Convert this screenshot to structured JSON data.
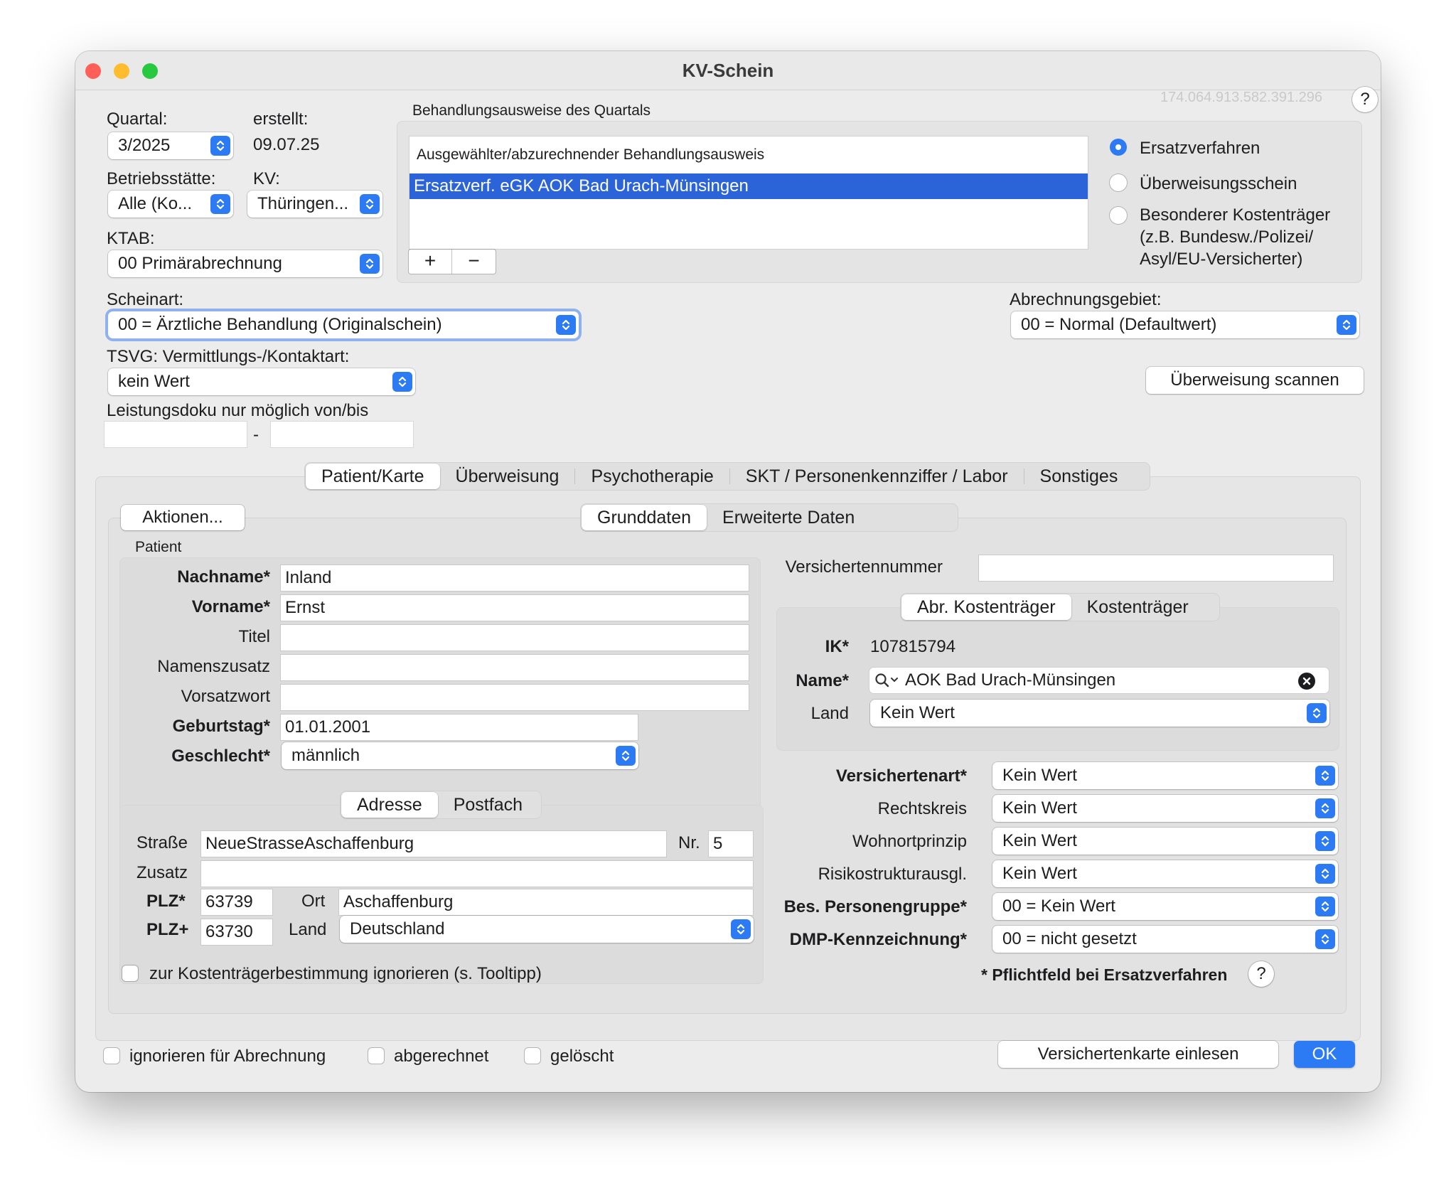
{
  "window": {
    "title": "KV-Schein",
    "id_text": "174.064.913.582.391.296"
  },
  "header": {
    "quartal_label": "Quartal:",
    "quartal_value": "3/2025",
    "erstellt_label": "erstellt:",
    "erstellt_value": "09.07.25",
    "betrieb_label": "Betriebsstätte:",
    "betrieb_value": "Alle (Ko...",
    "kv_label": "KV:",
    "kv_value": "Thüringen...",
    "ktab_label": "KTAB:",
    "ktab_value": "00 Primärabrechnung",
    "scheinart_label": "Scheinart:",
    "scheinart_value": "00 = Ärztliche Behandlung (Originalschein)",
    "abr_label": "Abrechnungsgebiet:",
    "abr_value": "00 = Normal (Defaultwert)",
    "tsvg_label": "TSVG: Vermittlungs-/Kontaktart:",
    "tsvg_value": "kein Wert",
    "leistung_label": "Leistungsdoku nur möglich von/bis",
    "dash": "-",
    "scan_button": "Überweisung scannen"
  },
  "behandlung": {
    "group_label": "Behandlungsausweise des Quartals",
    "list_header": "Ausgewählter/abzurechnender Behandlungsausweis",
    "selected_item": "Ersatzverf. eGK AOK Bad Urach-Münsingen",
    "add": "+",
    "remove": "−",
    "radio1": "Ersatzverfahren",
    "radio2": "Überweisungsschein",
    "radio3_line1": "Besonderer Kostenträger",
    "radio3_line2": "(z.B. Bundesw./Polizei/",
    "radio3_line3": "Asyl/EU-Versicherter)"
  },
  "tabs": [
    "Patient/Karte",
    "Überweisung",
    "Psychotherapie",
    "SKT / Personenkennziffer / Labor",
    "Sonstiges"
  ],
  "subtabs": [
    "Grunddaten",
    "Erweiterte Daten"
  ],
  "aktionen": "Aktionen...",
  "patient": {
    "group_label": "Patient",
    "nachname_label": "Nachname*",
    "nachname": "Inland",
    "vorname_label": "Vorname*",
    "vorname": "Ernst",
    "titel_label": "Titel",
    "titel": "",
    "namenszusatz_label": "Namenszusatz",
    "namenszusatz": "",
    "vorsatzwort_label": "Vorsatzwort",
    "vorsatzwort": "",
    "geburtstag_label": "Geburtstag*",
    "geburtstag": "01.01.2001",
    "geschlecht_label": "Geschlecht*",
    "geschlecht": "männlich"
  },
  "adresse": {
    "tabs": [
      "Adresse",
      "Postfach"
    ],
    "strasse_label": "Straße",
    "strasse": "NeueStrasseAschaffenburg",
    "nr_label": "Nr.",
    "nr": "5",
    "zusatz_label": "Zusatz",
    "zusatz": "",
    "plz_label": "PLZ*",
    "plz": "63739",
    "ort_label": "Ort",
    "ort": "Aschaffenburg",
    "plzplus_label": "PLZ+",
    "plzplus": "63730",
    "land_label": "Land",
    "land": "Deutschland",
    "ignore_label": "zur Kostenträgerbestimmung ignorieren (s. Tooltipp)"
  },
  "versicherung": {
    "vnr_label": "Versichertennummer",
    "vnr": "",
    "tabs": [
      "Abr. Kostenträger",
      "Kostenträger"
    ],
    "ik_label": "IK*",
    "ik": "107815794",
    "name_label": "Name*",
    "name": "AOK Bad Urach-Münsingen",
    "land_label": "Land",
    "land": "Kein Wert",
    "versichertenart_label": "Versichertenart*",
    "versichertenart": "Kein Wert",
    "rechtskreis_label": "Rechtskreis",
    "rechtskreis": "Kein Wert",
    "wohnort_label": "Wohnortprinzip",
    "wohnort": "Kein Wert",
    "risiko_label": "Risikostrukturausgl.",
    "risiko": "Kein Wert",
    "personengruppe_label": "Bes. Personengruppe*",
    "personengruppe": "00 = Kein Wert",
    "dmp_label": "DMP-Kennzeichnung*",
    "dmp": "00 = nicht gesetzt",
    "pflicht_note": "* Pflichtfeld bei Ersatzverfahren"
  },
  "footer": {
    "ignore": "ignorieren für Abrechnung",
    "abgerechnet": "abgerechnet",
    "geloescht": "gelöscht",
    "read_card": "Versichertenkarte einlesen",
    "ok": "OK"
  },
  "colors": {
    "accent": "#2d7bf4",
    "selection": "#2b63d9",
    "close": "#ff5f57",
    "minimize": "#febc2e",
    "zoom": "#28c840"
  },
  "help": "?"
}
